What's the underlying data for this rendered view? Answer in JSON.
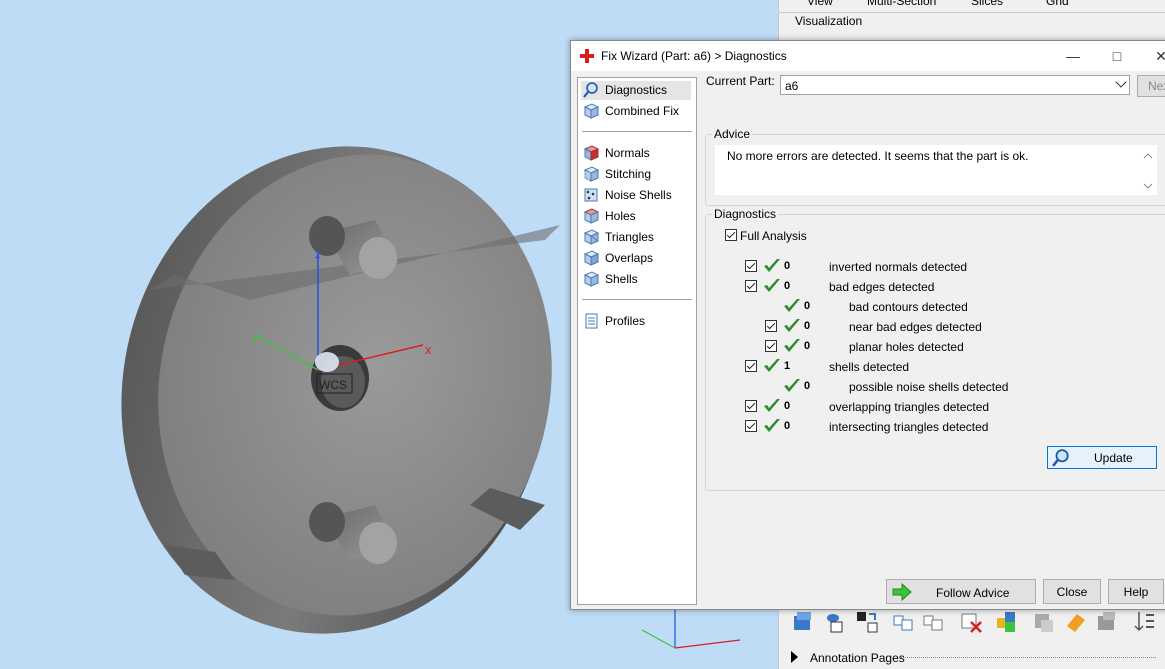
{
  "viewport": {
    "axis_labels": {
      "z": "z",
      "y": "y",
      "x": "x"
    },
    "wcs_label": "WCS"
  },
  "right_panel": {
    "tabs": [
      "View",
      "Multi-Section",
      "Slices",
      "Grid"
    ],
    "visualization_label": "Visualization",
    "annotation_label": "Annotation Pages"
  },
  "dialog": {
    "title": "Fix Wizard (Part: a6) > Diagnostics",
    "nav_items": [
      {
        "label": "Diagnostics",
        "icon": "magnifier-icon"
      },
      {
        "label": "Combined Fix",
        "icon": "cube-icon"
      },
      {
        "label": "Normals",
        "icon": "normals-cube-icon"
      },
      {
        "label": "Stitching",
        "icon": "stitching-icon"
      },
      {
        "label": "Noise Shells",
        "icon": "noise-shells-icon"
      },
      {
        "label": "Holes",
        "icon": "holes-icon"
      },
      {
        "label": "Triangles",
        "icon": "triangles-icon"
      },
      {
        "label": "Overlaps",
        "icon": "overlaps-icon"
      },
      {
        "label": "Shells",
        "icon": "shells-icon"
      },
      {
        "label": "Profiles",
        "icon": "document-icon"
      }
    ],
    "current_part_label": "Current Part:",
    "current_part_value": "a6",
    "next_label": "Next",
    "advice": {
      "label": "Advice",
      "text": "No more errors are detected. It seems that the part is ok."
    },
    "diagnostics": {
      "label": "Diagnostics",
      "full_analysis_label": "Full Analysis",
      "rows": [
        {
          "count": "0",
          "text": "inverted normals detected",
          "checkbox": true,
          "indent": 0
        },
        {
          "count": "0",
          "text": "bad edges detected",
          "checkbox": true,
          "indent": 0
        },
        {
          "count": "0",
          "text": "bad contours detected",
          "checkbox": false,
          "indent": 1
        },
        {
          "count": "0",
          "text": "near bad edges detected",
          "checkbox": true,
          "indent": 1
        },
        {
          "count": "0",
          "text": "planar holes detected",
          "checkbox": true,
          "indent": 1
        },
        {
          "count": "1",
          "text": "shells detected",
          "checkbox": true,
          "indent": 0
        },
        {
          "count": "0",
          "text": "possible noise shells detected",
          "checkbox": false,
          "indent": 1
        },
        {
          "count": "0",
          "text": "overlapping triangles detected",
          "checkbox": true,
          "indent": 0
        },
        {
          "count": "0",
          "text": "intersecting triangles detected",
          "checkbox": true,
          "indent": 0
        }
      ],
      "update_label": "Update"
    },
    "buttons": {
      "follow_advice": "Follow Advice",
      "close": "Close",
      "help": "Help"
    }
  },
  "colors": {
    "viewport_bg": "#bedcf6",
    "check_green": "#2e8b2e",
    "axis_x": "#d62020",
    "axis_y": "#3cc43c",
    "axis_z": "#2050e0"
  }
}
